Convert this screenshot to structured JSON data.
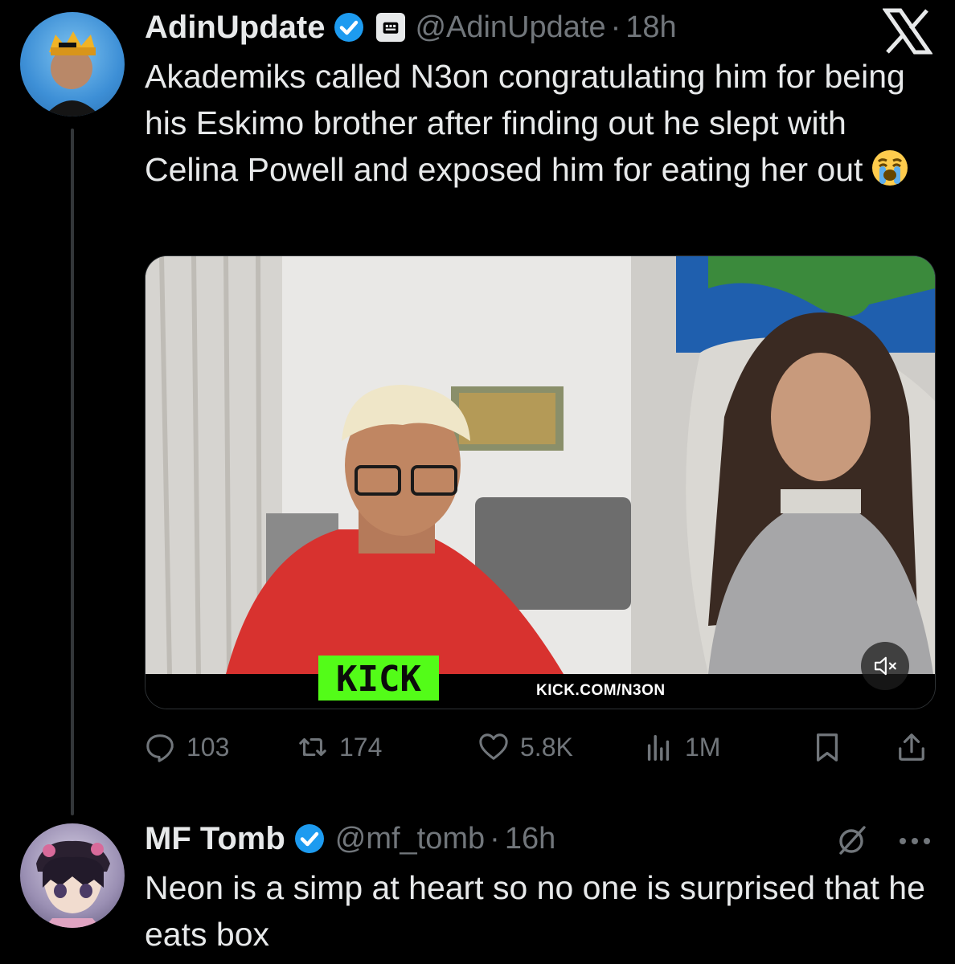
{
  "colors": {
    "background": "#000000",
    "text": "#e7e9ea",
    "muted": "#71767b",
    "verified": "#1d9bf0",
    "kick_green": "#53fc18"
  },
  "main_tweet": {
    "author_name": "AdinUpdate",
    "handle": "@AdinUpdate",
    "separator": "·",
    "time": "18h",
    "text": "Akademiks called N3on congratulating him for being his Eskimo brother after finding out he slept with Celina Powell and exposed him for eating her out",
    "emoji": "loudly-crying-face",
    "media": {
      "kick_logo": "KICK",
      "kick_url": "KICK.COM/N3ON",
      "mute_icon": "volume-muted-icon"
    },
    "actions": {
      "replies": "103",
      "retweets": "174",
      "likes": "5.8K",
      "views": "1M"
    }
  },
  "reply_tweet": {
    "author_name": "MF Tomb",
    "handle": "@mf_tomb",
    "separator": "·",
    "time": "16h",
    "text": "Neon is a simp at heart so no one is surprised that he eats box"
  },
  "icons": [
    "x-logo-icon",
    "verified-badge-icon",
    "affiliate-badge-icon",
    "reply-icon",
    "retweet-icon",
    "like-icon",
    "views-icon",
    "bookmark-icon",
    "share-icon",
    "grok-icon",
    "more-icon"
  ]
}
